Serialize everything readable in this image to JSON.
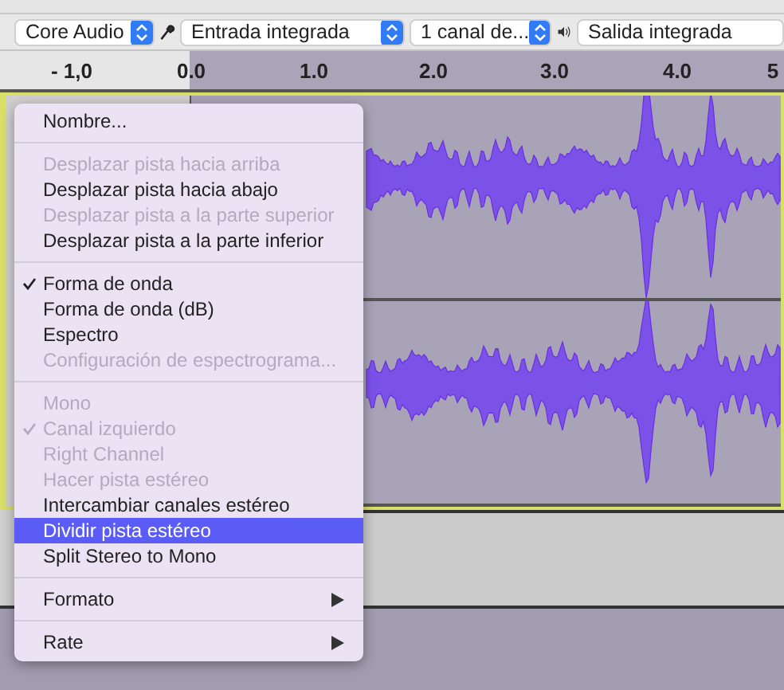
{
  "device_bar": {
    "host": "Core Audio",
    "input": "Entrada integrada",
    "channels": "1 canal de...",
    "output": "Salida integrada"
  },
  "ruler": {
    "labels": [
      "- 1,0",
      "0.0",
      "1.0",
      "2.0",
      "3.0",
      "4.0",
      "5"
    ]
  },
  "context_menu": {
    "items": [
      {
        "kind": "item",
        "label": "Nombre...",
        "disabled": false,
        "checked": false,
        "selected": false,
        "submenu": false
      },
      {
        "kind": "separator"
      },
      {
        "kind": "item",
        "label": "Desplazar pista hacia arriba",
        "disabled": true,
        "checked": false,
        "selected": false,
        "submenu": false
      },
      {
        "kind": "item",
        "label": "Desplazar pista hacia abajo",
        "disabled": false,
        "checked": false,
        "selected": false,
        "submenu": false
      },
      {
        "kind": "item",
        "label": "Desplazar pista a la parte superior",
        "disabled": true,
        "checked": false,
        "selected": false,
        "submenu": false
      },
      {
        "kind": "item",
        "label": "Desplazar pista a la parte inferior",
        "disabled": false,
        "checked": false,
        "selected": false,
        "submenu": false
      },
      {
        "kind": "separator"
      },
      {
        "kind": "item",
        "label": "Forma de onda",
        "disabled": false,
        "checked": true,
        "selected": false,
        "submenu": false
      },
      {
        "kind": "item",
        "label": "Forma de onda (dB)",
        "disabled": false,
        "checked": false,
        "selected": false,
        "submenu": false
      },
      {
        "kind": "item",
        "label": "Espectro",
        "disabled": false,
        "checked": false,
        "selected": false,
        "submenu": false
      },
      {
        "kind": "item",
        "label": "Configuración de espectrograma...",
        "disabled": true,
        "checked": false,
        "selected": false,
        "submenu": false
      },
      {
        "kind": "separator"
      },
      {
        "kind": "item",
        "label": "Mono",
        "disabled": true,
        "checked": false,
        "selected": false,
        "submenu": false
      },
      {
        "kind": "item",
        "label": "Canal izquierdo",
        "disabled": true,
        "checked": true,
        "selected": false,
        "submenu": false
      },
      {
        "kind": "item",
        "label": "Right Channel",
        "disabled": true,
        "checked": false,
        "selected": false,
        "submenu": false
      },
      {
        "kind": "item",
        "label": "Hacer pista estéreo",
        "disabled": true,
        "checked": false,
        "selected": false,
        "submenu": false
      },
      {
        "kind": "item",
        "label": "Intercambiar canales estéreo",
        "disabled": false,
        "checked": false,
        "selected": false,
        "submenu": false
      },
      {
        "kind": "item",
        "label": "Dividir pista estéreo",
        "disabled": false,
        "checked": false,
        "selected": true,
        "submenu": false
      },
      {
        "kind": "item",
        "label": "Split Stereo to Mono",
        "disabled": false,
        "checked": false,
        "selected": false,
        "submenu": false
      },
      {
        "kind": "separator"
      },
      {
        "kind": "item",
        "label": "Formato",
        "disabled": false,
        "checked": false,
        "selected": false,
        "submenu": true
      },
      {
        "kind": "separator"
      },
      {
        "kind": "item",
        "label": "Rate",
        "disabled": false,
        "checked": false,
        "selected": false,
        "submenu": true
      }
    ]
  }
}
